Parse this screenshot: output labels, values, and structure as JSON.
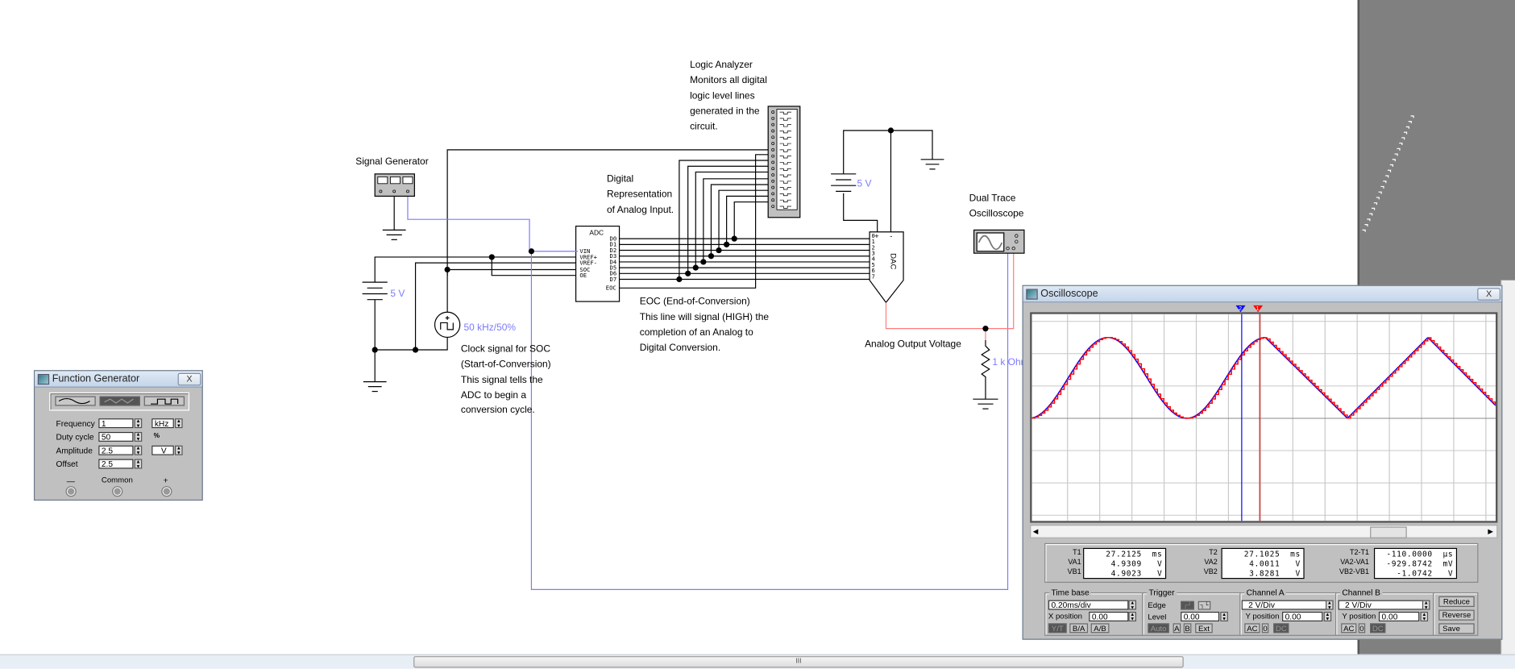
{
  "schematic": {
    "signal_generator_label": "Signal Generator",
    "logic_analyzer_lines": [
      "Logic Analyzer",
      "Monitors all digital",
      "logic level lines",
      "generated in the",
      "circuit."
    ],
    "digital_rep_lines": [
      "Digital",
      "Representation",
      "of Analog Input."
    ],
    "adc": {
      "title": "ADC",
      "left_pins": [
        "VIN",
        "VREF+",
        "VREF-",
        "SOC",
        "OE"
      ],
      "right_pins": [
        "D0",
        "D1",
        "D2",
        "D3",
        "D4",
        "D5",
        "D6",
        "D7",
        "EOC"
      ]
    },
    "dac": {
      "title": "DAC",
      "pins": [
        "0",
        "1",
        "2",
        "3",
        "4",
        "5",
        "6",
        "7"
      ],
      "plus": "+",
      "minus": "-"
    },
    "battery_left_label": "5 V",
    "battery_right_label": "5 V",
    "clock_label": "50 kHz/50%",
    "clock_note_lines": [
      "Clock signal for SOC",
      "(Start-of-Conversion)",
      "This signal tells the",
      "ADC to begin a",
      "conversion cycle."
    ],
    "eoc_note_lines": [
      "EOC (End-of-Conversion)",
      "This line will signal (HIGH) the",
      "completion of an Analog to",
      "Digital Conversion."
    ],
    "analog_output_label": "Analog Output Voltage",
    "resistor_label": "1 k Ohm",
    "scope_label_lines": [
      "Dual Trace",
      "Oscilloscope"
    ]
  },
  "scrollbar": {
    "thumb_label": "III"
  },
  "function_generator": {
    "title": "Function Generator",
    "close": "X",
    "waveforms": [
      "sine",
      "triangle",
      "square"
    ],
    "selected_waveform": "triangle",
    "rows": [
      {
        "label": "Frequency",
        "value": "1",
        "unit": "kHz"
      },
      {
        "label": "Duty cycle",
        "value": "50",
        "unit": "%"
      },
      {
        "label": "Amplitude",
        "value": "2.5",
        "unit": "V"
      },
      {
        "label": "Offset",
        "value": "2.5"
      }
    ],
    "terminals": {
      "minus": "—",
      "common": "Common",
      "plus": "+"
    }
  },
  "oscilloscope": {
    "title": "Oscilloscope",
    "close": "X",
    "colors": {
      "channel_a": "#0000ff",
      "channel_b": "#ff0000"
    },
    "cursors": [
      {
        "label": "2",
        "color": "#0000ff"
      },
      {
        "label": "1",
        "color": "#ff0000"
      }
    ],
    "readouts": {
      "col1": {
        "labels": [
          "T1",
          "VA1",
          "VB1"
        ],
        "values": [
          "27.2125  ms",
          "4.9309   V",
          "4.9023   V"
        ]
      },
      "col2": {
        "labels": [
          "T2",
          "VA2",
          "VB2"
        ],
        "values": [
          "27.1025  ms",
          "4.0011   V",
          "3.8281   V"
        ]
      },
      "col3": {
        "labels": [
          "T2-T1",
          "VA2-VA1",
          "VB2-VB1"
        ],
        "values": [
          "-110.0000  µs",
          "-929.8742  mV",
          "-1.0742   V"
        ]
      }
    },
    "timebase": {
      "title": "Time base",
      "scale": "0.20ms/div",
      "xpos_label": "X position",
      "xpos": "0.00",
      "modes": [
        "Y/T",
        "B/A",
        "A/B"
      ],
      "active_mode": "Y/T"
    },
    "trigger": {
      "title": "Trigger",
      "edge_label": "Edge",
      "level_label": "Level",
      "level": "0.00",
      "sources": [
        "Auto",
        "A",
        "B",
        "Ext"
      ],
      "active_source": "Auto",
      "rising": "┌┘",
      "falling": "┐└"
    },
    "channel_a": {
      "title": "Channel A",
      "scale": "2 V/Div",
      "ypos_label": "Y position",
      "ypos": "0.00",
      "coupling": [
        "AC",
        "0",
        "DC"
      ],
      "active": "DC"
    },
    "channel_b": {
      "title": "Channel B",
      "scale": "2 V/Div",
      "ypos_label": "Y position",
      "ypos": "0.00",
      "coupling": [
        "AC",
        "0",
        "DC"
      ],
      "active": "DC"
    },
    "buttons": [
      "Reduce",
      "Reverse",
      "Save"
    ]
  }
}
